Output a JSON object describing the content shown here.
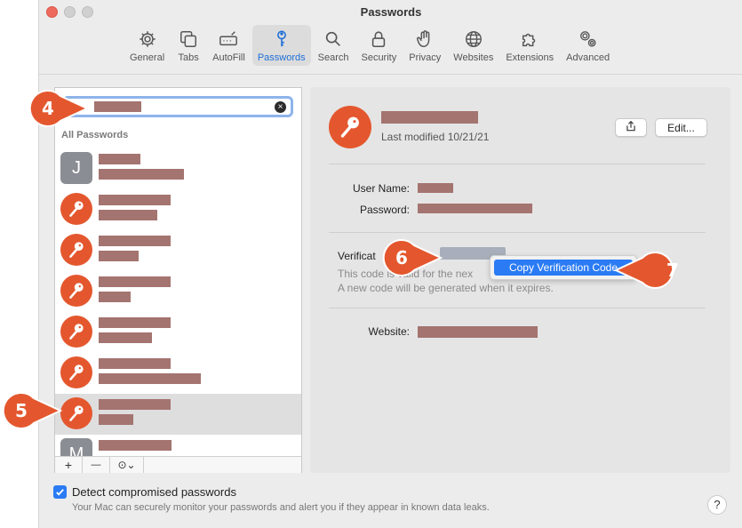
{
  "window": {
    "title": "Passwords"
  },
  "toolbar": {
    "items": [
      {
        "label": "General",
        "icon": "gear-icon"
      },
      {
        "label": "Tabs",
        "icon": "tabs-icon"
      },
      {
        "label": "AutoFill",
        "icon": "autofill-icon"
      },
      {
        "label": "Passwords",
        "icon": "key-icon",
        "active": true
      },
      {
        "label": "Search",
        "icon": "search-icon"
      },
      {
        "label": "Security",
        "icon": "lock-icon"
      },
      {
        "label": "Privacy",
        "icon": "hand-icon"
      },
      {
        "label": "Websites",
        "icon": "globe-icon"
      },
      {
        "label": "Extensions",
        "icon": "puzzle-icon"
      },
      {
        "label": "Advanced",
        "icon": "gears-icon"
      }
    ]
  },
  "list": {
    "search_clear": "×",
    "header": "All Passwords",
    "letter_avatar_j": "J",
    "letter_avatar_m": "M"
  },
  "list_footer": {
    "add": "+",
    "remove": "—",
    "more": "⊙⌄"
  },
  "detail": {
    "last_modified": "Last modified 10/21/21",
    "edit_button": "Edit...",
    "user_name_label": "User Name:",
    "password_label": "Password:",
    "verification_label": "Verificat",
    "verification_hint_1": "This code is valid for the nex",
    "verification_hint_2": "A new code will be generated when it expires.",
    "website_label": "Website:"
  },
  "context_menu": {
    "copy_item": "Copy Verification Code"
  },
  "footer": {
    "checkbox_label": "Detect compromised passwords",
    "checkbox_sub": "Your Mac can securely monitor your passwords and alert you if they appear in known data leaks.",
    "help": "?"
  },
  "callouts": {
    "c4": "4",
    "c5": "5",
    "c6": "6",
    "c7": "7"
  },
  "colors": {
    "accent": "#2a7bf4",
    "callout": "#e4572e",
    "redaction": "#a47470"
  }
}
